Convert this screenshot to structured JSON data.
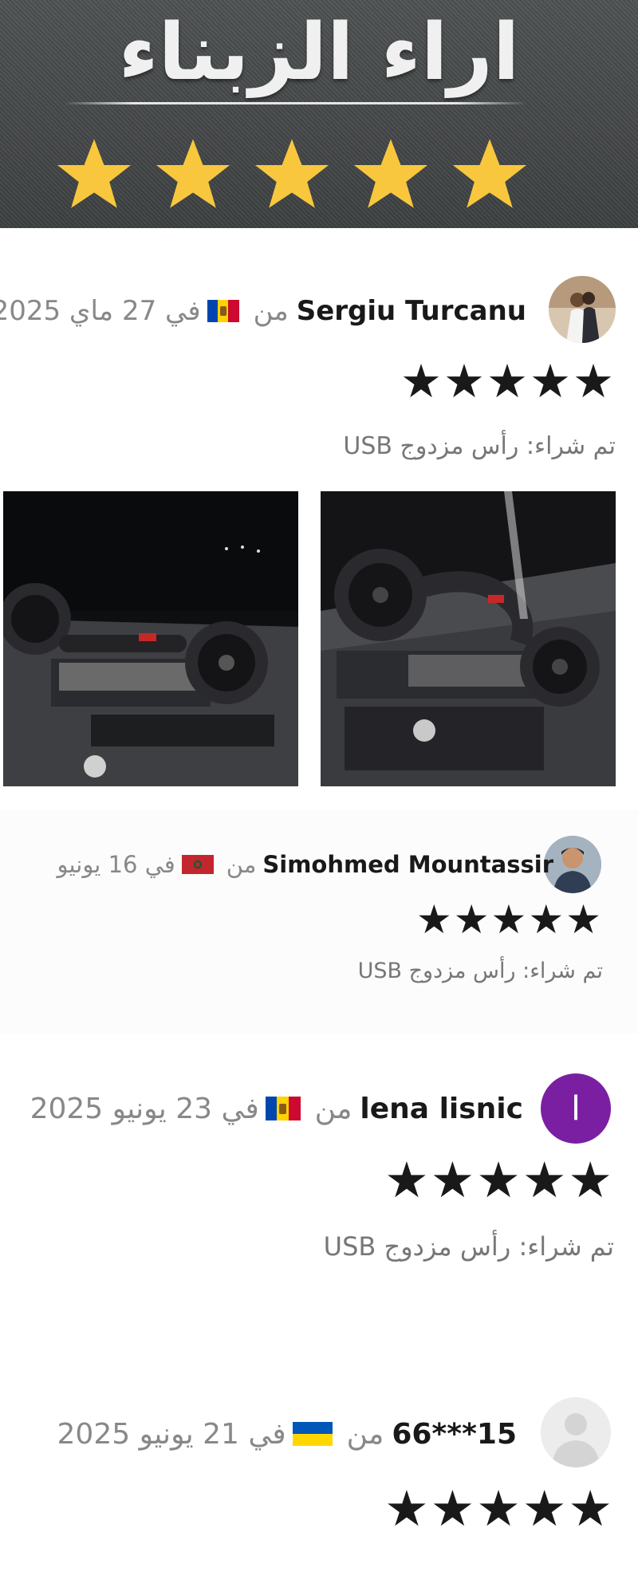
{
  "banner": {
    "title": "اراء الزبناء",
    "star_color": "#f8c73d",
    "rating": 5
  },
  "reviews": [
    {
      "author": "Sergiu Turcanu",
      "from_word": "من",
      "date": "في 27 ماي 2025",
      "country_flag": "Moldova",
      "stars": "★★★★★",
      "purchased": "تم شراء: رأس مزدوج USB",
      "avatar_icon": "user-photo-avatar",
      "photos": [
        "review-photo-1",
        "review-photo-2"
      ]
    },
    {
      "author": "Simohmed Mountassir",
      "from_word": "من",
      "date": "في 16 يونيو",
      "country_flag": "Morocco",
      "stars": "★★★★★",
      "purchased": "تم شراء: رأس مزدوج USB",
      "avatar_icon": "user-photo-avatar"
    },
    {
      "author": "lena lisnic",
      "from_word": "من",
      "date": "في 23 يونيو 2025",
      "country_flag": "Moldova",
      "avatar_letter": "l",
      "avatar_color": "#7b1fa2",
      "stars": "★★★★★",
      "purchased": "تم شراء: رأس مزدوج USB"
    },
    {
      "author": "66***15",
      "from_word": "من",
      "date": "في 21 يونيو 2025",
      "country_flag": "Ukraine",
      "avatar_icon": "default-user-avatar",
      "stars": "★★★★★"
    }
  ],
  "colors": {
    "text_dark": "#191919",
    "text_muted": "#888888",
    "moldova": [
      "#0046ae",
      "#ffd200",
      "#cc092f"
    ],
    "morocco": [
      "#c1272d",
      "#006233"
    ],
    "ukraine": [
      "#0057b7",
      "#ffd700"
    ]
  }
}
